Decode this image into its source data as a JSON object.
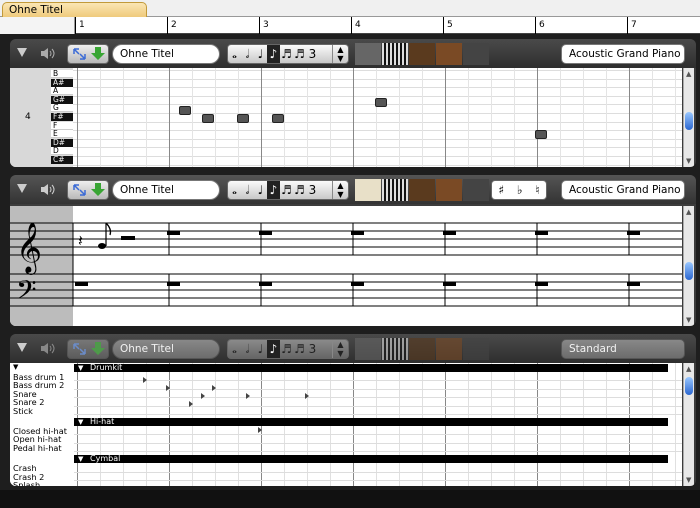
{
  "window": {
    "tab_title": "Ohne Titel"
  },
  "ruler": {
    "measures": [
      "1",
      "2",
      "3",
      "4",
      "5",
      "6",
      "7"
    ]
  },
  "tracks": [
    {
      "id": "piano-roll",
      "name": "Ohne Titel",
      "instrument": "Acoustic Grand Piano",
      "octave_label": "4",
      "keys": [
        {
          "label": "B",
          "black": false
        },
        {
          "label": "A#",
          "black": true
        },
        {
          "label": "A",
          "black": false
        },
        {
          "label": "G#",
          "black": true
        },
        {
          "label": "G",
          "black": false
        },
        {
          "label": "F#",
          "black": true
        },
        {
          "label": "F",
          "black": false
        },
        {
          "label": "E",
          "black": false
        },
        {
          "label": "D#",
          "black": true
        },
        {
          "label": "D",
          "black": false
        },
        {
          "label": "C#",
          "black": true
        }
      ]
    },
    {
      "id": "score",
      "name": "Ohne Titel",
      "instrument": "Acoustic Grand Piano",
      "accidentals": [
        "♯",
        "♭",
        "♮"
      ]
    },
    {
      "id": "drums",
      "name": "Ohne Titel",
      "instrument": "Standard",
      "groups": [
        {
          "name": "Drumkit",
          "items": [
            "Bass drum 1",
            "Bass drum 2",
            "Snare",
            "Snare 2",
            "Stick"
          ]
        },
        {
          "name": "Hi-hat",
          "items": [
            "Closed hi-hat",
            "Open hi-hat",
            "Pedal hi-hat"
          ]
        },
        {
          "name": "Cymbal",
          "items": [
            "Crash",
            "Crash 2",
            "Splash"
          ]
        }
      ]
    }
  ],
  "note_tools": [
    "𝅝",
    "𝅗𝅥",
    "♩",
    "♪",
    "♬",
    "♬",
    "3"
  ],
  "colors": {
    "tab": "#eec878",
    "track_bg": "#3c3c3c",
    "scroll_thumb": "#2b67d1"
  }
}
